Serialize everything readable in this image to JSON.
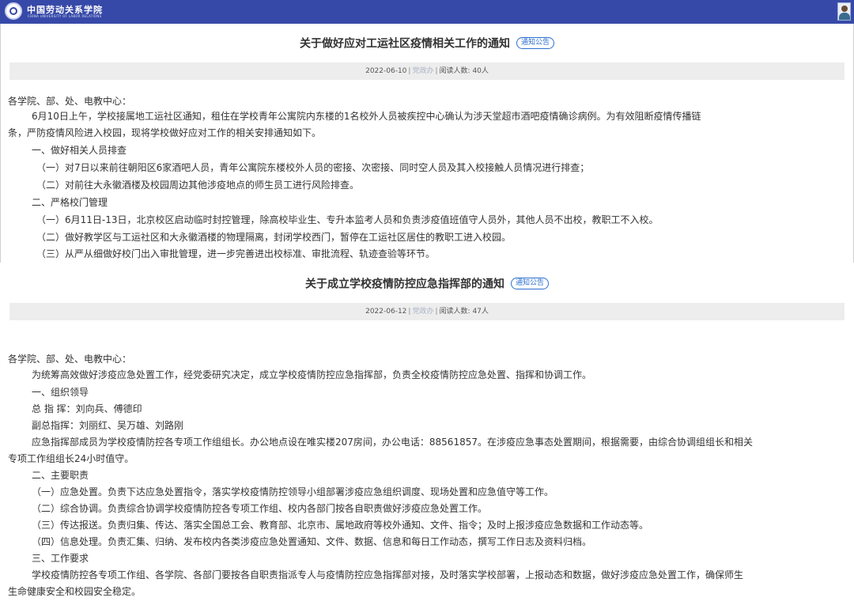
{
  "header": {
    "logo_cn": "中国劳动关系学院",
    "logo_en": "CHINA UNIVERSITY OF LABOR RELATIONS"
  },
  "notice1": {
    "title": "关于做好应对工运社区疫情相关工作的通知",
    "badge": "通知公告",
    "date": "2022-06-10",
    "source": "党政办",
    "views_label": "阅读人数:",
    "views": "40人",
    "lines": [
      "各学院、部、处、电教中心：",
      "6月10日上午，学校接属地工运社区通知，租住在学校青年公寓院内东楼的1名校外人员被疾控中心确认为涉天堂超市酒吧疫情确诊病例。为有效阻断疫情传播链",
      "条，严防疫情风险进入校园，现将学校做好应对工作的相关安排通知如下。",
      "一、做好相关人员排查",
      "（一）对7日以来前往朝阳区6家酒吧人员，青年公寓院东楼校外人员的密接、次密接、同时空人员及其入校接触人员情况进行排查；",
      "（二）对前往大永徽酒楼及校园周边其他涉疫地点的师生员工进行风险排查。",
      "二、严格校门管理",
      "（一）6月11日-13日，北京校区启动临时封控管理，除高校毕业生、专升本监考人员和负责涉疫值班值守人员外，其他人员不出校，教职工不入校。",
      "（二）做好教学区与工运社区和大永徽酒楼的物理隔离，封闭学校西门，暂停在工运社区居住的教职工进入校园。",
      "（三）从严从细做好校门出入审批管理，进一步完善进出校标准、审批流程、轨迹查验等环节。"
    ]
  },
  "notice2": {
    "title": "关于成立学校疫情防控应急指挥部的通知",
    "badge": "通知公告",
    "date": "2022-06-12",
    "source": "党政办",
    "views_label": "阅读人数:",
    "views": "47人",
    "lines": [
      "各学院、部、处、电教中心：",
      "为统筹高效做好涉疫应急处置工作，经党委研究决定，成立学校疫情防控应急指挥部，负责全校疫情防控应急处置、指挥和协调工作。",
      "一、组织领导",
      "总 指 挥：刘向兵、傅德印",
      "副总指挥：刘丽红、吴万雄、刘路刚",
      "应急指挥部成员为学校疫情防控各专项工作组组长。办公地点设在唯实楼207房间，办公电话：88561857。在涉疫应急事态处置期间，根据需要，由综合协调组组长和相关",
      "专项工作组组长24小时值守。",
      "二、主要职责",
      "（一）应急处置。负责下达应急处置指令，落实学校疫情防控领导小组部署涉疫应急组织调度、现场处置和应急值守等工作。",
      "（二）综合协调。负责综合协调学校疫情防控各专项工作组、校内各部门按各自职责做好涉疫应急处置工作。",
      "（三）传达报送。负责归集、传达、落实全国总工会、教育部、北京市、属地政府等校外通知、文件、指令；及时上报涉疫应急数据和工作动态等。",
      "（四）信息处理。负责汇集、归纳、发布校内各类涉疫应急处置通知、文件、数据、信息和每日工作动态，撰写工作日志及资料归档。",
      "三、工作要求",
      "学校疫情防控各专项工作组、各学院、各部门要按各自职责指派专人与疫情防控应急指挥部对接，及时落实学校部署，上报动态和数据，做好涉疫应急处置工作，确保师生",
      "生命健康安全和校园安全稳定。"
    ]
  }
}
